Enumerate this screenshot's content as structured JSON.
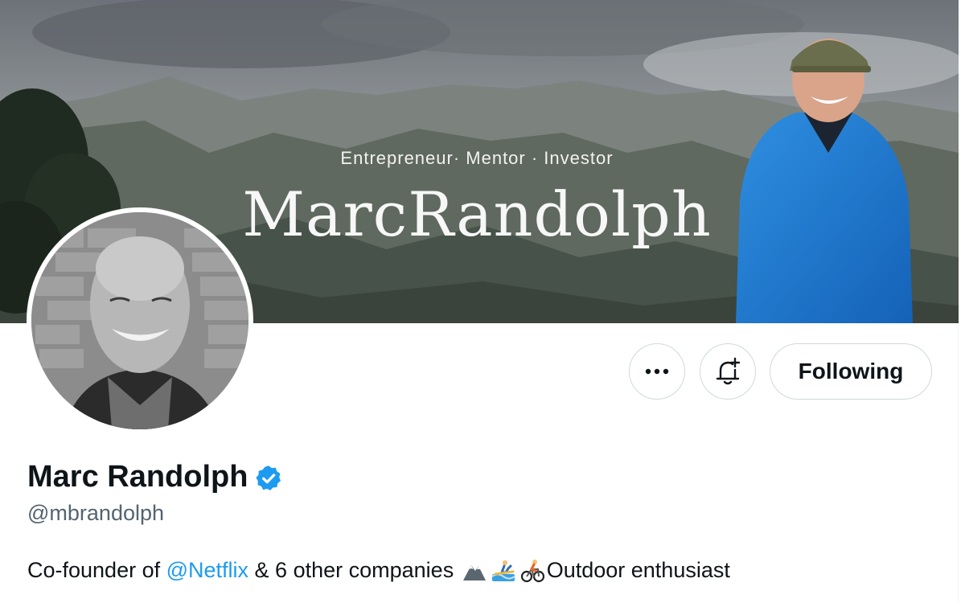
{
  "banner": {
    "tagline": "Entrepreneur· Mentor · Investor",
    "title": "MarcRandolph"
  },
  "profile": {
    "display_name": "Marc Randolph",
    "verified": true,
    "handle": "@mbrandolph",
    "bio": {
      "prefix": "Co-founder of ",
      "mention": "@Netflix",
      "middle": " & 6 other companies ",
      "suffix": "Outdoor enthusiast",
      "emojis": [
        "mountain-icon",
        "surfer-icon",
        "cyclist-icon"
      ]
    }
  },
  "actions": {
    "more_icon": "more-dots-icon",
    "notify_icon": "bell-plus-icon",
    "follow_label": "Following"
  },
  "colors": {
    "accent": "#1d9bf0",
    "secondary_text": "#536471",
    "border": "#cfd9de"
  }
}
